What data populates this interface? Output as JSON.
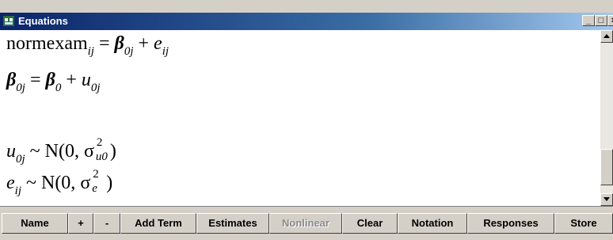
{
  "window": {
    "title": "Equations"
  },
  "equations": {
    "line1": {
      "lhs": "normexam",
      "lhs_sub": "ij",
      "eq": "=",
      "beta": "β",
      "beta_sub": "0j",
      "plus": "+",
      "e": "e",
      "e_sub": "ij"
    },
    "line2": {
      "beta": "β",
      "beta_sub": "0j",
      "eq": "=",
      "beta2": "β",
      "beta2_sub": "0",
      "plus": "+",
      "u": "u",
      "u_sub": "0j"
    },
    "line3": {
      "u": "u",
      "u_sub": "0j",
      "tilde": "~",
      "dist": "N(0,",
      "sigma": "σ",
      "sigma_sup": "2",
      "sigma_sub": "u0",
      "close": ")"
    },
    "line4": {
      "e": "e",
      "e_sub": "ij",
      "tilde": "~",
      "dist": "N(0,",
      "sigma": "σ",
      "sigma_sup": "2",
      "sigma_sub": "e",
      "close": ")"
    }
  },
  "toolbar": {
    "name": "Name",
    "plus": "+",
    "minus": "-",
    "add_term": "Add Term",
    "estimates": "Estimates",
    "nonlinear": "Nonlinear",
    "clear": "Clear",
    "notation": "Notation",
    "responses": "Responses",
    "store": "Store"
  },
  "titlebar_buttons": {
    "minimize": "_",
    "maximize": "□",
    "close": "×"
  }
}
